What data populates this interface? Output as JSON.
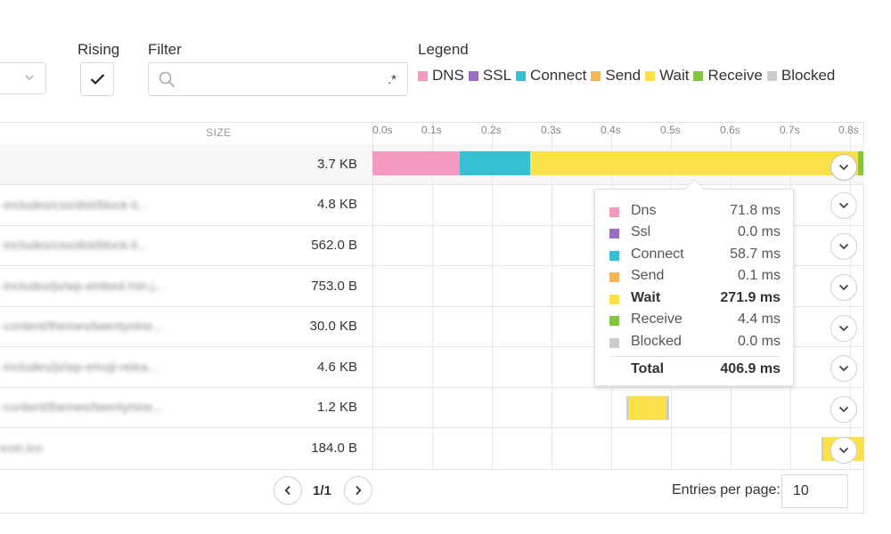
{
  "toolbar": {
    "rising_label": "Rising",
    "rising_checked": true,
    "filter_label": "Filter",
    "filter_value": "",
    "filter_regex_symbol": ".*",
    "legend_title": "Legend",
    "legend": [
      {
        "label": "DNS",
        "color": "#f49ac1"
      },
      {
        "label": "SSL",
        "color": "#9b6fc0"
      },
      {
        "label": "Connect",
        "color": "#36c0d1"
      },
      {
        "label": "Send",
        "color": "#f3b556"
      },
      {
        "label": "Wait",
        "color": "#fbe24a"
      },
      {
        "label": "Receive",
        "color": "#82c341"
      },
      {
        "label": "Blocked",
        "color": "#cccccc"
      }
    ]
  },
  "table": {
    "size_header": "SIZE",
    "ticks": [
      "0.0s",
      "0.1s",
      "0.2s",
      "0.3s",
      "0.4s",
      "0.5s",
      "0.6s",
      "0.7s",
      "0.8s"
    ],
    "rows": [
      {
        "url": "",
        "size": "3.7 KB"
      },
      {
        "url": "-includes/css/dist/block-li...",
        "size": "4.8 KB"
      },
      {
        "url": "-includes/css/dist/block-li...",
        "size": "562.0 B"
      },
      {
        "url": "-includes/js/wp-embed.min.j...",
        "size": "753.0 B"
      },
      {
        "url": "-content/themes/twentynine...",
        "size": "30.0 KB"
      },
      {
        "url": "-includes/js/wp-emoji-relea...",
        "size": "4.6 KB"
      },
      {
        "url": "-content/themes/twentynine...",
        "size": "1.2 KB"
      },
      {
        "url": "icon.ico",
        "size": "184.0 B"
      }
    ]
  },
  "tooltip": {
    "items": [
      {
        "name": "Dns",
        "value": "71.8 ms",
        "color": "#f49ac1"
      },
      {
        "name": "Ssl",
        "value": "0.0 ms",
        "color": "#9b6fc0"
      },
      {
        "name": "Connect",
        "value": "58.7 ms",
        "color": "#36c0d1"
      },
      {
        "name": "Send",
        "value": "0.1 ms",
        "color": "#f3b556"
      },
      {
        "name": "Wait",
        "value": "271.9 ms",
        "color": "#fbe24a"
      },
      {
        "name": "Receive",
        "value": "4.4 ms",
        "color": "#82c341"
      },
      {
        "name": "Blocked",
        "value": "0.0 ms",
        "color": "#cccccc"
      }
    ],
    "total_label": "Total",
    "total_value": "406.9 ms"
  },
  "pagination": {
    "page": "1/1",
    "entries_label": "Entries per page:",
    "entries_value": "10"
  }
}
